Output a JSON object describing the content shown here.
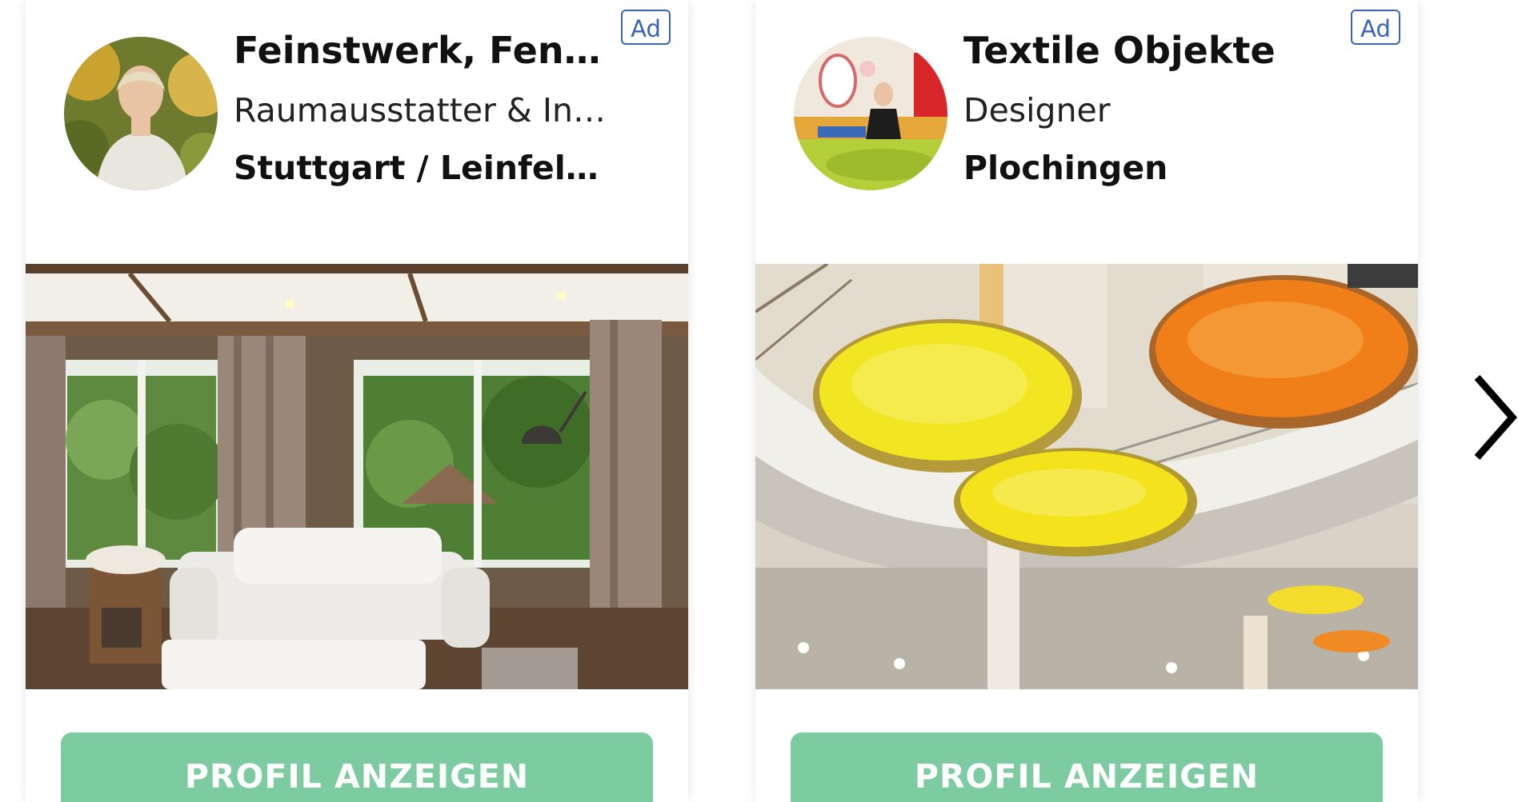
{
  "carousel": {
    "next_icon": "chevron-right-icon",
    "cards": [
      {
        "ad_label": "Ad",
        "name": "Feinstwerk, Feng...",
        "category": "Raumausstatter & Interi...",
        "location": "Stuttgart / Leinfeld...",
        "cta_label": "PROFIL ANZEIGEN"
      },
      {
        "ad_label": "Ad",
        "name": "Textile Objekte",
        "category": "Designer",
        "location": "Plochingen",
        "cta_label": "PROFIL ANZEIGEN"
      }
    ]
  },
  "colors": {
    "cta_background": "#7dcba0",
    "ad_badge": "#3a63b8"
  }
}
